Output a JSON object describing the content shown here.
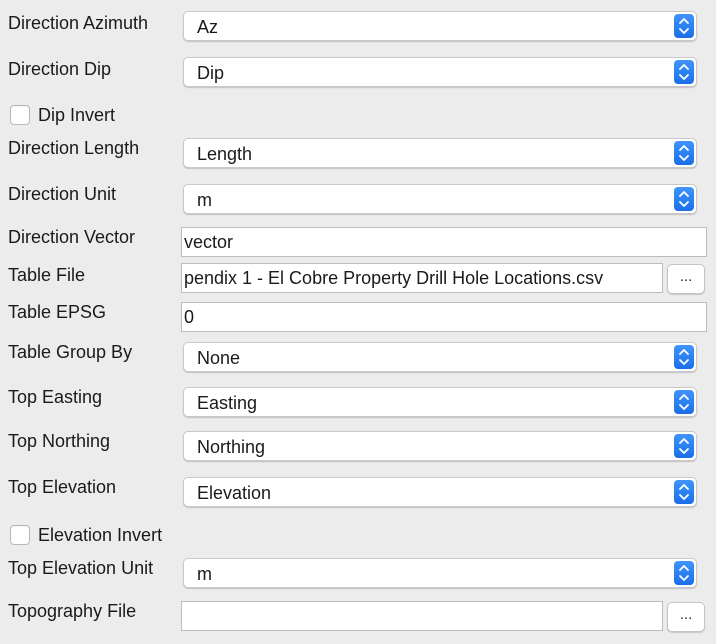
{
  "form": {
    "direction_azimuth": {
      "label": "Direction Azimuth",
      "value": "Az"
    },
    "direction_dip": {
      "label": "Direction Dip",
      "value": "Dip"
    },
    "dip_invert": {
      "label": "Dip Invert",
      "checked": false
    },
    "direction_length": {
      "label": "Direction Length",
      "value": "Length"
    },
    "direction_unit": {
      "label": "Direction Unit",
      "value": "m"
    },
    "direction_vector": {
      "label": "Direction Vector",
      "value": "vector"
    },
    "table_file": {
      "label": "Table File",
      "value": "pendix 1 - El Cobre Property Drill Hole Locations.csv",
      "browse_label": "..."
    },
    "table_epsg": {
      "label": "Table EPSG",
      "value": "0"
    },
    "table_group_by": {
      "label": "Table Group By",
      "value": "None"
    },
    "top_easting": {
      "label": "Top Easting",
      "value": "Easting"
    },
    "top_northing": {
      "label": "Top Northing",
      "value": "Northing"
    },
    "top_elevation": {
      "label": "Top Elevation",
      "value": "Elevation"
    },
    "elevation_invert": {
      "label": "Elevation Invert",
      "checked": false
    },
    "top_elevation_unit": {
      "label": "Top Elevation Unit",
      "value": "m"
    },
    "topography_file": {
      "label": "Topography File",
      "value": "",
      "browse_label": "..."
    }
  },
  "colors": {
    "background": "#ececec",
    "accent": "#2d84f5"
  },
  "icons": {
    "combo_arrows": "up-down-chevron-icon"
  }
}
